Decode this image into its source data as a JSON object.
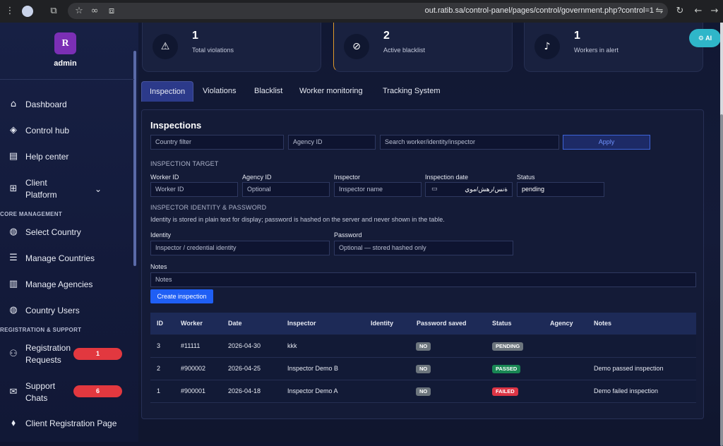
{
  "browser": {
    "url": "out.ratib.sa/control-panel/pages/control/government.php?control=1"
  },
  "sidebar": {
    "avatar_letter": "R",
    "user": "admin",
    "items": [
      {
        "label": "Dashboard",
        "icon": "home-icon"
      },
      {
        "label": "Control hub",
        "icon": "layers-icon"
      },
      {
        "label": "Help center",
        "icon": "book-icon"
      },
      {
        "label": "Client\nPlatform",
        "icon": "grid-icon"
      },
      {
        "label": "Select Country",
        "icon": "globe-icon"
      },
      {
        "label": "Manage Countries",
        "icon": "list-icon"
      },
      {
        "label": "Manage Agencies",
        "icon": "building-icon"
      },
      {
        "label": "Country Users",
        "icon": "globe-user-icon"
      },
      {
        "label": "Registration\nRequests",
        "icon": "user-plus-icon"
      },
      {
        "label": "Support\nChats",
        "icon": "chat-icon"
      },
      {
        "label": "Client Registration Page",
        "icon": "tag-icon"
      }
    ],
    "sections": {
      "core": "CORE MANAGEMENT",
      "registration": "REGISTRATION & SUPPORT"
    },
    "badges": {
      "registration_requests": "1",
      "support_chats": "6"
    }
  },
  "stats": [
    {
      "value": "1",
      "label": "Total violations",
      "icon": "warning-icon"
    },
    {
      "value": "2",
      "label": "Active blacklist",
      "icon": "ban-icon"
    },
    {
      "value": "1",
      "label": "Workers in alert",
      "icon": "bell-icon"
    }
  ],
  "ai_button": "AI",
  "tabs": [
    "Inspection",
    "Violations",
    "Blacklist",
    "Worker monitoring",
    "Tracking System"
  ],
  "inspections": {
    "title": "Inspections",
    "filters": {
      "country_placeholder": "Country filter",
      "agency_placeholder": "Agency ID",
      "search_placeholder": "Search worker/identity/inspector",
      "apply": "Apply"
    },
    "target_heading": "INSPECTION TARGET",
    "labels": {
      "worker_id": "Worker ID",
      "agency_id": "Agency ID",
      "inspector": "Inspector",
      "date": "Inspection date",
      "status": "Status",
      "identity": "Identity",
      "password": "Password",
      "notes": "Notes"
    },
    "inputs": {
      "worker_id_placeholder": "Worker ID",
      "agency_id_placeholder": "Optional",
      "inspector_placeholder": "Inspector name",
      "date_value": "ةنس/رهش/موي",
      "status_value": "pending",
      "identity_placeholder": "Inspector / credential identity",
      "password_placeholder": "Optional — stored hashed only",
      "notes_placeholder": "Notes"
    },
    "identity_heading": "INSPECTOR IDENTITY & PASSWORD",
    "identity_note": "Identity is stored in plain text for display; password is hashed on the server and never shown in the table.",
    "create_button": "Create inspection",
    "table": {
      "headers": [
        "ID",
        "Worker",
        "Date",
        "Inspector",
        "Identity",
        "Password saved",
        "Status",
        "Agency",
        "Notes"
      ],
      "rows": [
        {
          "id": "3",
          "worker": "#11111",
          "date": "2026-04-30",
          "inspector": "kkk",
          "identity": "",
          "password": "NO",
          "status": "PENDING",
          "status_color": "#6c757d",
          "agency": "",
          "notes": ""
        },
        {
          "id": "2",
          "worker": "#900002",
          "date": "2026-04-25",
          "inspector": "Inspector Demo B",
          "identity": "",
          "password": "NO",
          "status": "PASSED",
          "status_color": "#198754",
          "agency": "",
          "notes": "Demo passed inspection"
        },
        {
          "id": "1",
          "worker": "#900001",
          "date": "2026-04-18",
          "inspector": "Inspector Demo A",
          "identity": "",
          "password": "NO",
          "status": "FAILED",
          "status_color": "#dc3545",
          "agency": "",
          "notes": "Demo failed inspection"
        }
      ]
    }
  }
}
